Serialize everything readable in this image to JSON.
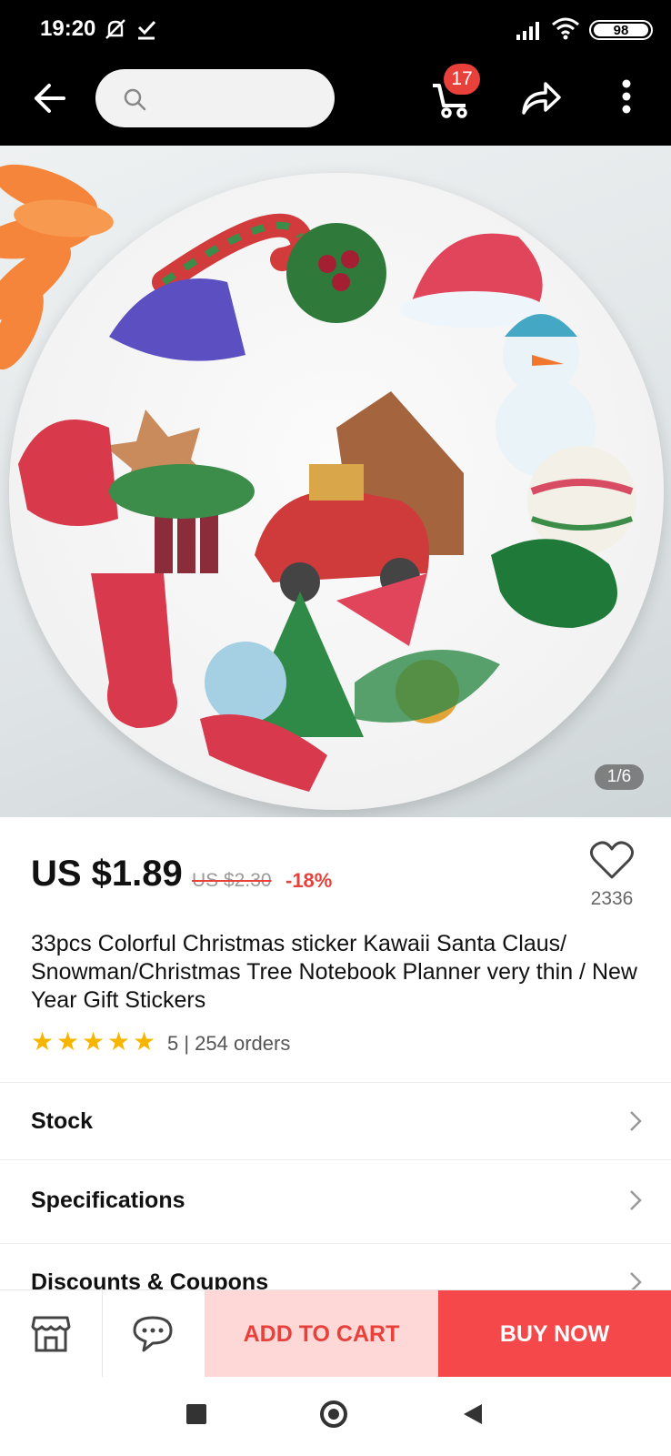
{
  "status_bar": {
    "time": "19:20",
    "battery": "98"
  },
  "top_bar": {
    "search_placeholder": "",
    "cart_count": "17"
  },
  "gallery": {
    "pager": "1/6"
  },
  "product": {
    "price": "US $1.89",
    "old_price": "US $2.30",
    "discount": "-18%",
    "wishlist_count": "2336",
    "title": "33pcs Colorful Christmas sticker Kawaii Santa Claus/ Snowman/Christmas Tree Notebook Planner very thin / New Year Gift Stickers",
    "rating": "5",
    "orders": "5 | 254 orders"
  },
  "sections": [
    {
      "label": "Stock"
    },
    {
      "label": "Specifications"
    },
    {
      "label": "Discounts & Coupons"
    }
  ],
  "actions": {
    "add_to_cart": "ADD TO CART",
    "buy_now": "BUY NOW"
  },
  "colors": {
    "accent": "#e8413c",
    "add_cart_bg": "#fdd8d6",
    "buy_now_bg": "#f5484a"
  }
}
